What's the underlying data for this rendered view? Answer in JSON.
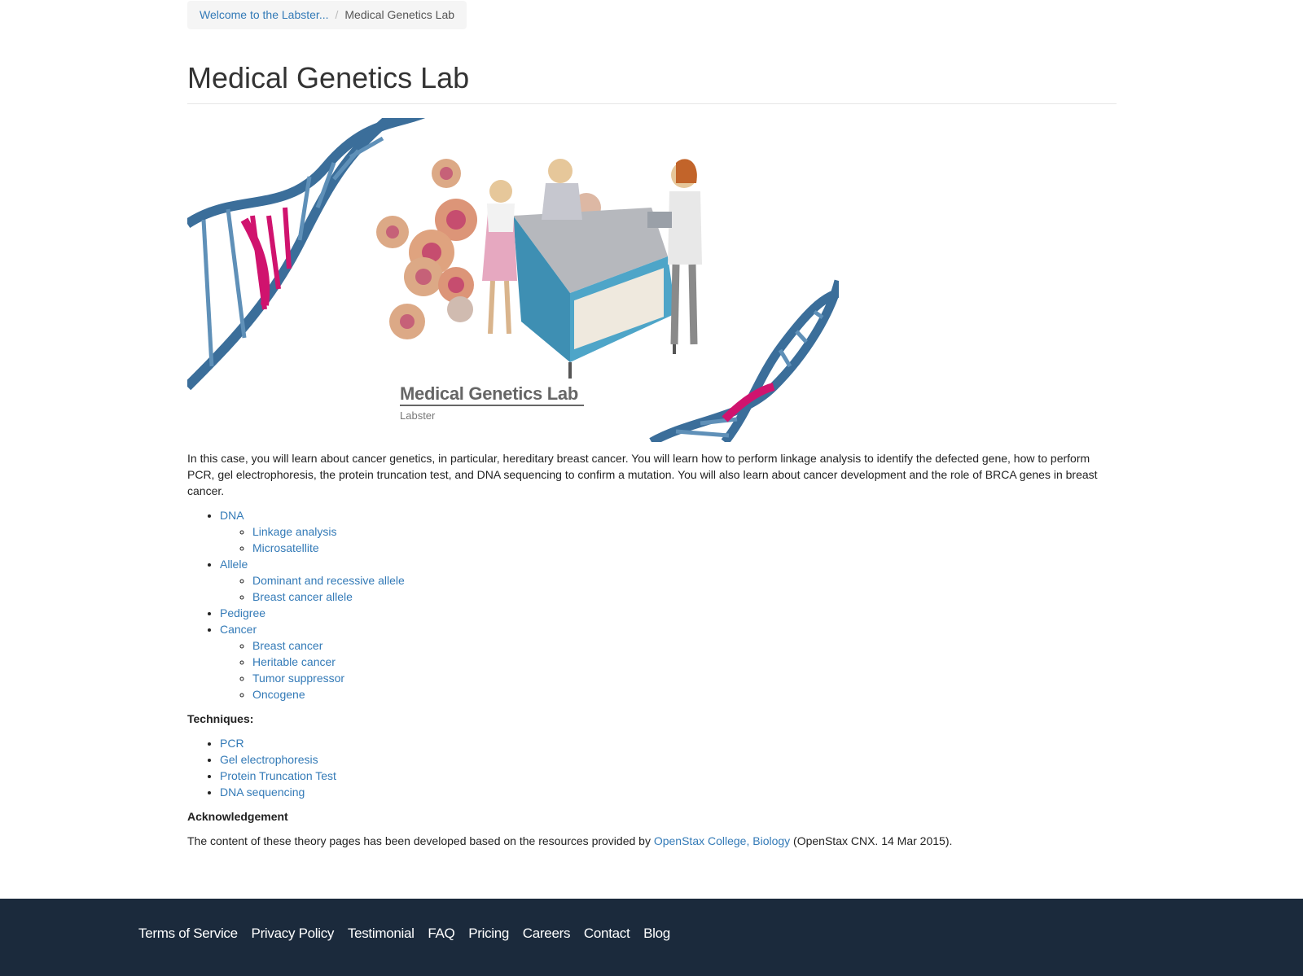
{
  "breadcrumb": {
    "home": "Welcome to the Labster...",
    "separator": "/",
    "current": "Medical Genetics Lab"
  },
  "page_title": "Medical Genetics Lab",
  "hero": {
    "caption_title": "Medical Genetics Lab",
    "caption_subtitle": "Labster"
  },
  "intro": "In this case, you will learn about cancer genetics, in particular, hereditary breast cancer. You will learn how to perform linkage analysis to identify the defected gene, how to perform PCR, gel electrophoresis, the protein truncation test, and DNA sequencing to confirm a mutation. You will also learn about cancer development and the role of BRCA genes in breast cancer.",
  "topics": [
    {
      "label": "DNA",
      "children": [
        "Linkage analysis",
        "Microsatellite"
      ]
    },
    {
      "label": "Allele",
      "children": [
        "Dominant and recessive allele",
        "Breast cancer allele"
      ]
    },
    {
      "label": "Pedigree",
      "children": []
    },
    {
      "label": "Cancer",
      "children": [
        "Breast cancer",
        "Heritable cancer",
        "Tumor suppressor",
        "Oncogene"
      ]
    }
  ],
  "techniques": {
    "heading": "Techniques:",
    "items": [
      "PCR",
      "Gel electrophoresis",
      "Protein Truncation Test",
      "DNA sequencing"
    ]
  },
  "acknowledgement": {
    "heading": "Acknowledgement",
    "text_before": "The content of these theory pages has been developed based on the resources provided by ",
    "link": "OpenStax College, Biology",
    "text_after": " (OpenStax CNX. 14 Mar 2015)."
  },
  "footer": {
    "links": [
      "Terms of Service",
      "Privacy Policy",
      "Testimonial",
      "FAQ",
      "Pricing",
      "Careers",
      "Contact",
      "Blog"
    ],
    "background": "#1b2a3c"
  },
  "colors": {
    "link": "#337ab7",
    "dna_blue": "#3b6e9a",
    "dna_magenta": "#d0136e"
  }
}
